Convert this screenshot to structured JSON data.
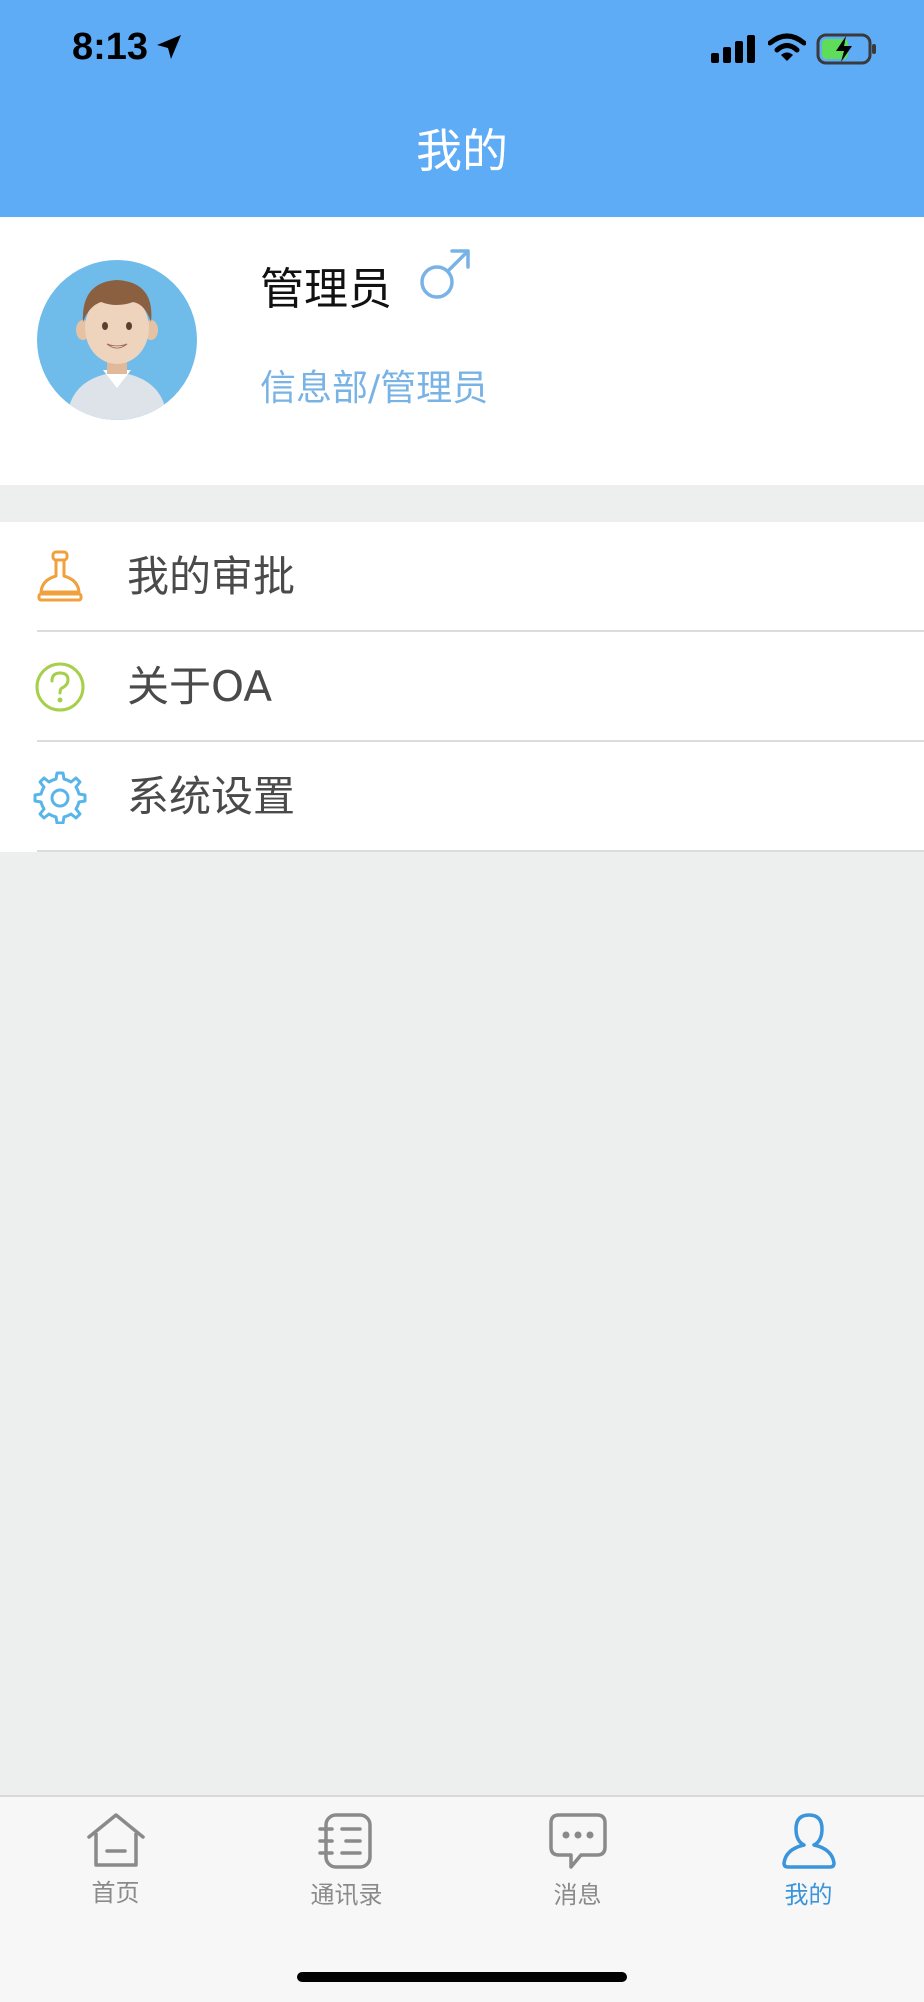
{
  "status_bar": {
    "time": "8:13"
  },
  "header": {
    "title": "我的"
  },
  "profile": {
    "name": "管理员",
    "department": "信息部/管理员"
  },
  "menu": {
    "items": [
      {
        "label": "我的审批",
        "icon": "stamp-icon"
      },
      {
        "label": "关于OA",
        "icon": "question-circle-icon"
      },
      {
        "label": "系统设置",
        "icon": "gear-icon"
      }
    ]
  },
  "tab_bar": {
    "tabs": [
      {
        "label": "首页",
        "icon": "home-icon"
      },
      {
        "label": "通讯录",
        "icon": "contacts-icon"
      },
      {
        "label": "消息",
        "icon": "message-icon"
      },
      {
        "label": "我的",
        "icon": "person-icon",
        "active": true
      }
    ]
  },
  "colors": {
    "header_bg": "#5eabf6",
    "accent": "#3a95dc",
    "stamp_icon": "#f0a03c",
    "question_icon": "#a6cf4a",
    "gear_icon": "#58b5ea",
    "dept_text": "#79b3e6"
  }
}
